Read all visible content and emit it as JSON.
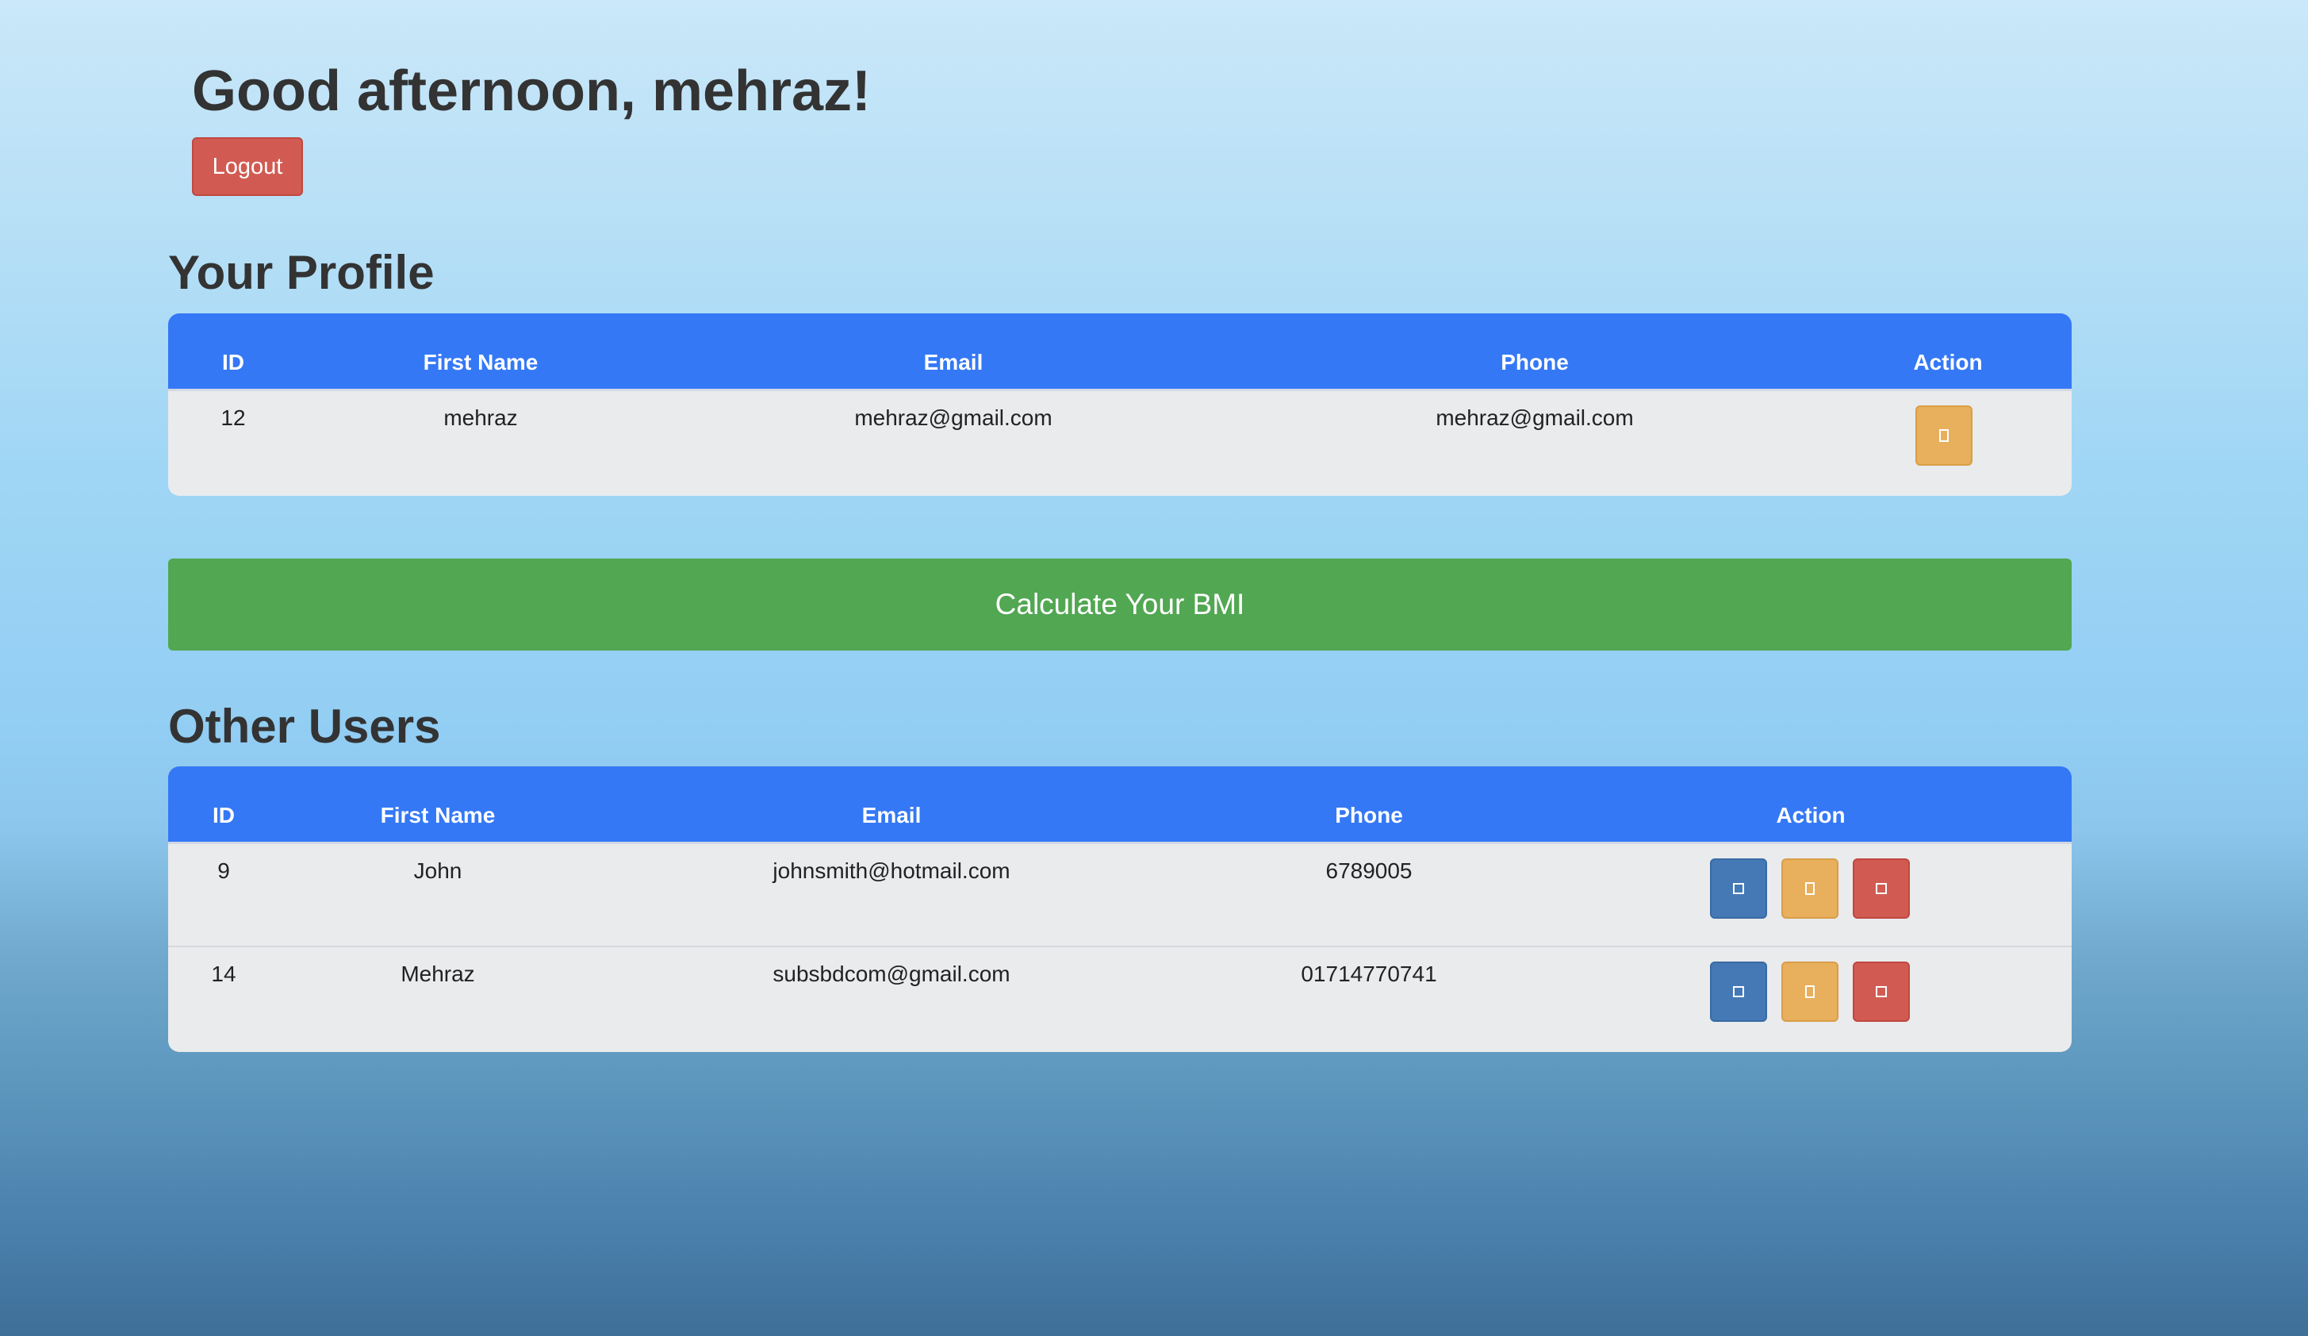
{
  "greeting": "Good afternoon, mehraz!",
  "logout_label": "Logout",
  "profile": {
    "title": "Your Profile",
    "headers": [
      "ID",
      "First Name",
      "Email",
      "Phone",
      "Action"
    ],
    "row": {
      "id": "12",
      "first_name": "mehraz",
      "email": "mehraz@gmail.com",
      "phone": "mehraz@gmail.com"
    },
    "actions": [
      {
        "icon": "edit-icon",
        "color": "#e8af5c"
      }
    ]
  },
  "bmi_button_label": "Calculate Your BMI",
  "others": {
    "title": "Other Users",
    "headers": [
      "ID",
      "First Name",
      "Email",
      "Phone",
      "Action"
    ],
    "rows": [
      {
        "id": "9",
        "first_name": "John",
        "email": "johnsmith@hotmail.com",
        "phone": "6789005"
      },
      {
        "id": "14",
        "first_name": "Mehraz",
        "email": "subsbdcom@gmail.com",
        "phone": "01714770741"
      }
    ],
    "actions": [
      {
        "icon": "view-icon",
        "color": "#4479b6"
      },
      {
        "icon": "edit-icon",
        "color": "#e8af5c"
      },
      {
        "icon": "delete-icon",
        "color": "#d15b52"
      }
    ]
  },
  "colors": {
    "table_header": "#3478f6",
    "table_body": "#e9ebed",
    "bmi_button": "#52a752",
    "logout_button": "#d15b52"
  }
}
